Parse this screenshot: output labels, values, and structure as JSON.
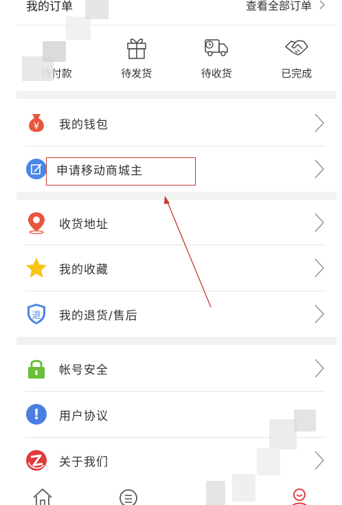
{
  "orders": {
    "title": "我的订单",
    "view_all": "查看全部订单",
    "tabs": [
      {
        "label": "待付款",
        "icon": "wallet-icon"
      },
      {
        "label": "待发货",
        "icon": "gift-icon"
      },
      {
        "label": "待收货",
        "icon": "truck-icon"
      },
      {
        "label": "已完成",
        "icon": "handshake-icon"
      }
    ]
  },
  "menu": {
    "wallet": "我的钱包",
    "apply_owner": "申请移动商城主",
    "address": "收货地址",
    "favorites": "我的收藏",
    "returns": "我的退货/售后",
    "security": "帐号安全",
    "agreement": "用户协议",
    "about": "关于我们"
  },
  "icon_glyphs": {
    "wallet_symbol": "¥",
    "returns_symbol": "退",
    "agreement_symbol": "!"
  },
  "colors": {
    "wallet": "#e9553b",
    "edit": "#4a86e8",
    "location": "#e9553b",
    "star": "#f5c518",
    "shield": "#4a86e8",
    "lock": "#6abf3b",
    "info": "#4a7fe0",
    "about": "#e23a3a",
    "annotation": "#c0392b",
    "tab_active": "#e23a3a"
  },
  "tab_bar": [
    {
      "icon": "home-icon"
    },
    {
      "icon": "category-icon"
    },
    {
      "icon": "cart-icon"
    },
    {
      "icon": "profile-icon"
    }
  ]
}
